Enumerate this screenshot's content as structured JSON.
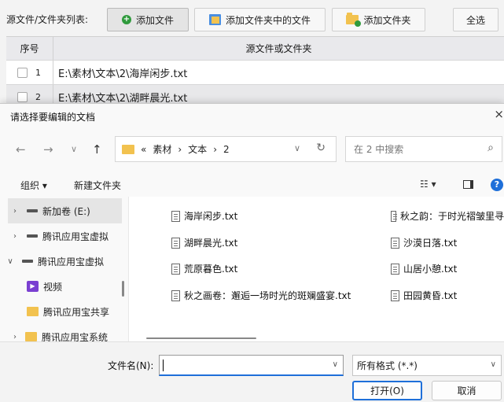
{
  "app": {
    "toolbar": {
      "list_label": "源文件/文件夹列表:",
      "add_file": "添加文件",
      "add_files_in_folder": "添加文件夹中的文件",
      "add_folder": "添加文件夹",
      "select_all": "全选"
    },
    "table": {
      "col_no": "序号",
      "col_source": "源文件或文件夹",
      "rows": [
        {
          "no": "1",
          "path": "E:\\素材\\文本\\2\\海岸闲步.txt"
        },
        {
          "no": "2",
          "path": "E:\\素材\\文本\\2\\湖畔晨光.txt"
        }
      ]
    }
  },
  "dialog": {
    "title": "请选择要编辑的文档",
    "close_glyph": "×",
    "nav": {
      "back": "←",
      "forward": "→",
      "recent": "∨",
      "up": "↑"
    },
    "address": {
      "overflow": "«",
      "crumbs": [
        "素材",
        "文本",
        "2"
      ],
      "sep": "›",
      "caret": "∨",
      "refresh": "↻"
    },
    "search": {
      "placeholder": "在 2 中搜索",
      "icon": "⌕"
    },
    "commands": {
      "organize": "组织 ▾",
      "new_folder": "新建文件夹",
      "view": "☷ ▾",
      "help": "?"
    },
    "sidebar": {
      "items": [
        {
          "label": "新加卷 (E:)",
          "chevron": "›",
          "icon": "drive"
        },
        {
          "label": "腾讯应用宝虚拟",
          "chevron": "›",
          "icon": "drive"
        },
        {
          "label": "腾讯应用宝虚拟",
          "chevron": "∨",
          "icon": "drive"
        },
        {
          "label": "视频",
          "chevron": "",
          "icon": "video"
        },
        {
          "label": "腾讯应用宝共享",
          "chevron": "",
          "icon": "folder"
        },
        {
          "label": "腾讯应用宝系统",
          "chevron": "›",
          "icon": "folder"
        }
      ]
    },
    "files": [
      "海岸闲步.txt",
      "湖畔晨光.txt",
      "荒原暮色.txt",
      "秋之画卷：邂逅一场时光的斑斓盛宴.txt",
      "秋之韵：于时光褶皱里寻",
      "沙漠日落.txt",
      "山居小憩.txt",
      "田园黄昏.txt"
    ],
    "bottom": {
      "filename_label": "文件名(N):",
      "filename_value": "",
      "format_value": "所有格式 (*.*)",
      "caret": "∨",
      "open": "打开(O)",
      "cancel": "取消"
    }
  }
}
